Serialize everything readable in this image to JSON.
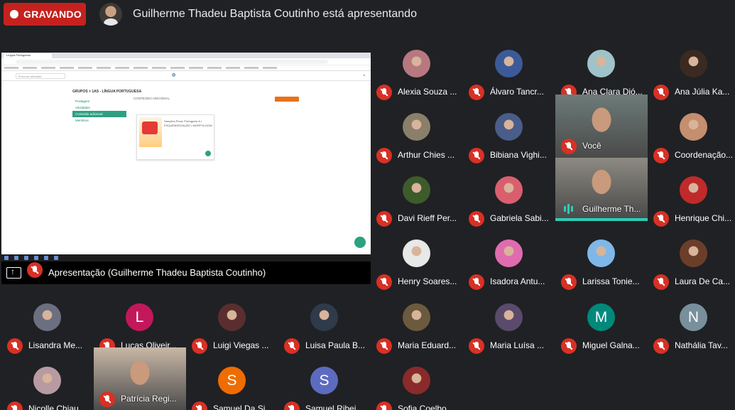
{
  "recording_label": "GRAVANDO",
  "presenting_title": "Guilherme Thadeu Baptista Coutinho está apresentando",
  "presentation": {
    "label": "Apresentação (Guilherme Thadeu Baptista Coutinho)",
    "browser_tab": "Língua Portuguesa",
    "breadcrumb": "GRUPOS > 1AS - LÍNGUA PORTUGUESA",
    "search_placeholder": "Procurar atividade",
    "nav_items": [
      "Postagem",
      "Atividades",
      "Conteúdo adicional",
      "Membros"
    ],
    "content_title": "CONTEÚDO ADICIONAL",
    "card_text": "Sanções Pena: Portugueis 8 • ESQUEMATIZAÇÃO • MORFOLOGIA"
  },
  "colors": {
    "accent": "#2bcfb4",
    "mic_off": "#d93025",
    "recording": "#c5221f"
  },
  "participants": [
    {
      "name": "Alexia Souza ...",
      "type": "avatar",
      "color": "#b8787f"
    },
    {
      "name": "Álvaro Tancr...",
      "type": "avatar",
      "color": "#3c5a9a"
    },
    {
      "name": "Ana Clara Dió...",
      "type": "avatar",
      "color": "#9fc3c8"
    },
    {
      "name": "Ana Júlia Ka...",
      "type": "avatar",
      "color": "#3a2a22"
    },
    {
      "name": "Arthur Chies ...",
      "type": "avatar",
      "color": "#8a7f6a"
    },
    {
      "name": "Bibiana Vighi...",
      "type": "avatar",
      "color": "#4a5c8a"
    },
    {
      "name": "Você",
      "type": "video",
      "color": "#6d7b78"
    },
    {
      "name": "Coordenação...",
      "type": "avatar",
      "color": "#c48e6f"
    },
    {
      "name": "Davi Rieff Per...",
      "type": "avatar",
      "color": "#3d5b2b"
    },
    {
      "name": "Gabriela Sabi...",
      "type": "avatar",
      "color": "#d95f6f"
    },
    {
      "name": "Guilherme Th...",
      "type": "video",
      "color": "#8d8a82"
    },
    {
      "name": "Henrique Chi...",
      "type": "avatar",
      "color": "#c02a2a"
    },
    {
      "name": "Henry Soares...",
      "type": "avatar",
      "color": "#e8e8e8"
    },
    {
      "name": "Isadora Antu...",
      "type": "avatar",
      "color": "#e06cb0"
    },
    {
      "name": "Larissa Tonie...",
      "type": "avatar",
      "color": "#7fb8e8"
    },
    {
      "name": "Laura De Ca...",
      "type": "avatar",
      "color": "#6b3e2a"
    },
    {
      "name": "Lisandra Me...",
      "type": "avatar",
      "color": "#6b6f7f"
    },
    {
      "name": "Lucas Oliveir...",
      "type": "letter",
      "letter": "L",
      "color": "#c2185b"
    },
    {
      "name": "Luigi Viegas ...",
      "type": "avatar",
      "color": "#5a2e2e"
    },
    {
      "name": "Luisa Paula B...",
      "type": "avatar",
      "color": "#2f3a4a"
    },
    {
      "name": "Maria Eduard...",
      "type": "avatar",
      "color": "#6b5a3e"
    },
    {
      "name": "Maria Luísa ...",
      "type": "avatar",
      "color": "#5a4a6b"
    },
    {
      "name": "Miguel Galna...",
      "type": "letter",
      "letter": "M",
      "color": "#00897b"
    },
    {
      "name": "Nathália Tav...",
      "type": "letter",
      "letter": "N",
      "color": "#78909c"
    },
    {
      "name": "Nicolle Chiau...",
      "type": "avatar",
      "color": "#b89aa2"
    },
    {
      "name": "Patrícia Regi...",
      "type": "video",
      "color": "#c8b7a6"
    },
    {
      "name": "Samuel Da Si...",
      "type": "letter",
      "letter": "S",
      "color": "#ef6c00"
    },
    {
      "name": "Samuel Ribei...",
      "type": "letter",
      "letter": "S",
      "color": "#5c6bc0"
    },
    {
      "name": "Sofia Coelho ...",
      "type": "avatar",
      "color": "#8a2a2a"
    }
  ]
}
